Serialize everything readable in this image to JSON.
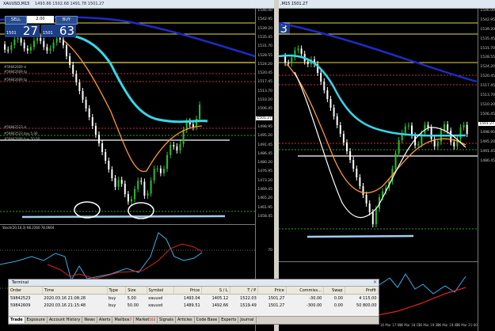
{
  "left_chart": {
    "title": "XAUUSD,M15",
    "ohlc": "1493.86 1502.68 1491.78 1501.27",
    "trade_panel": {
      "sell_label": "SELL",
      "buy_label": "BUY",
      "lot": "2.00",
      "sell_small": "1501",
      "sell_big": "27",
      "buy_small": "1501",
      "buy_big": "63"
    },
    "price_axis": [
      "1546.00",
      "1542.95",
      "1539.20",
      "1535.45",
      "1531.70",
      "1528.55",
      "1524.20",
      "1520.45",
      "1517.45",
      "1513.70",
      "1510.20",
      "1506.45",
      "1501.27",
      "1498.95",
      "1495.20",
      "1491.45",
      "1486.45",
      "1480.20",
      "1476.95",
      "1473.20",
      "1469.45",
      "1465.20",
      "1461.95",
      "1458.45"
    ],
    "highlight_yellow": "1520.00",
    "highlight_white": "1501.27",
    "order_labels": [
      "#59842609 sl",
      "#59842609 tp",
      "#59842609 tp",
      "#59842523 sl",
      "#59842523 buy 5.00",
      "#59842609 buy 50.00"
    ],
    "indicator_title": "Stoch(20,10,3) 66.2260 78.0664",
    "indicator_axis": [
      "100",
      "70",
      "30",
      "0"
    ]
  },
  "right_chart": {
    "title": ",M15 1501.27",
    "panel_big": "3",
    "price_axis": [
      "1546.00",
      "1542.95",
      "1539.20",
      "1535.45",
      "1531.70",
      "1528.55",
      "1524.20",
      "1520.45",
      "1517.45",
      "1513.70",
      "1510.20",
      "1506.45",
      "1501.27",
      "1498.95",
      "1495.20",
      "1491.45",
      "1486.45"
    ],
    "date_labels": [
      "16 Mar 17:00",
      "16 Mar 18:15",
      "16 Mar 19:30",
      "16 Mar 19:40",
      "16 Mar 21:00"
    ]
  },
  "terminal": {
    "title": "Terminal",
    "columns": [
      "Order",
      "Time",
      "Type",
      "Size",
      "Symbol",
      "Price",
      "S / L",
      "T / P",
      "Price",
      "Commiss...",
      "Swap",
      "Profit"
    ],
    "rows": [
      [
        "59842523",
        "2020.03.16 21:08:28",
        "buy",
        "5.00",
        "xauusd",
        "1493.04",
        "1405.12",
        "1522.03",
        "1501.27",
        "-30.00",
        "0.00",
        "4 115.00"
      ],
      [
        "59842609",
        "2020.03.16 21:15:48",
        "buy",
        "50.00",
        "xauusd",
        "1489.51",
        "1492.66",
        "1519.49",
        "1501.27",
        "-300.00",
        "0.00",
        "50 800.00"
      ]
    ],
    "tabs": [
      "Trade",
      "Exposure",
      "Account History",
      "News",
      "Alerts",
      "Mailbox",
      "Market",
      "Signals",
      "Articles",
      "Code Base",
      "Experts",
      "Journal"
    ],
    "mailbox_badge": "7",
    "market_badge": "103"
  },
  "colors": {
    "bull": "#29c029",
    "bear": "#ffffff",
    "ma_slow": "#1a2cc8",
    "ma_cyan": "#36d8e8",
    "ma_orange": "#ff9a2a",
    "ma_white": "#ffffff",
    "stoch_main": "#38b0e8",
    "stoch_signal": "#e02020",
    "level_yellow": "#e8d84a",
    "level_red": "#c83030",
    "level_green": "#2aa02a"
  }
}
